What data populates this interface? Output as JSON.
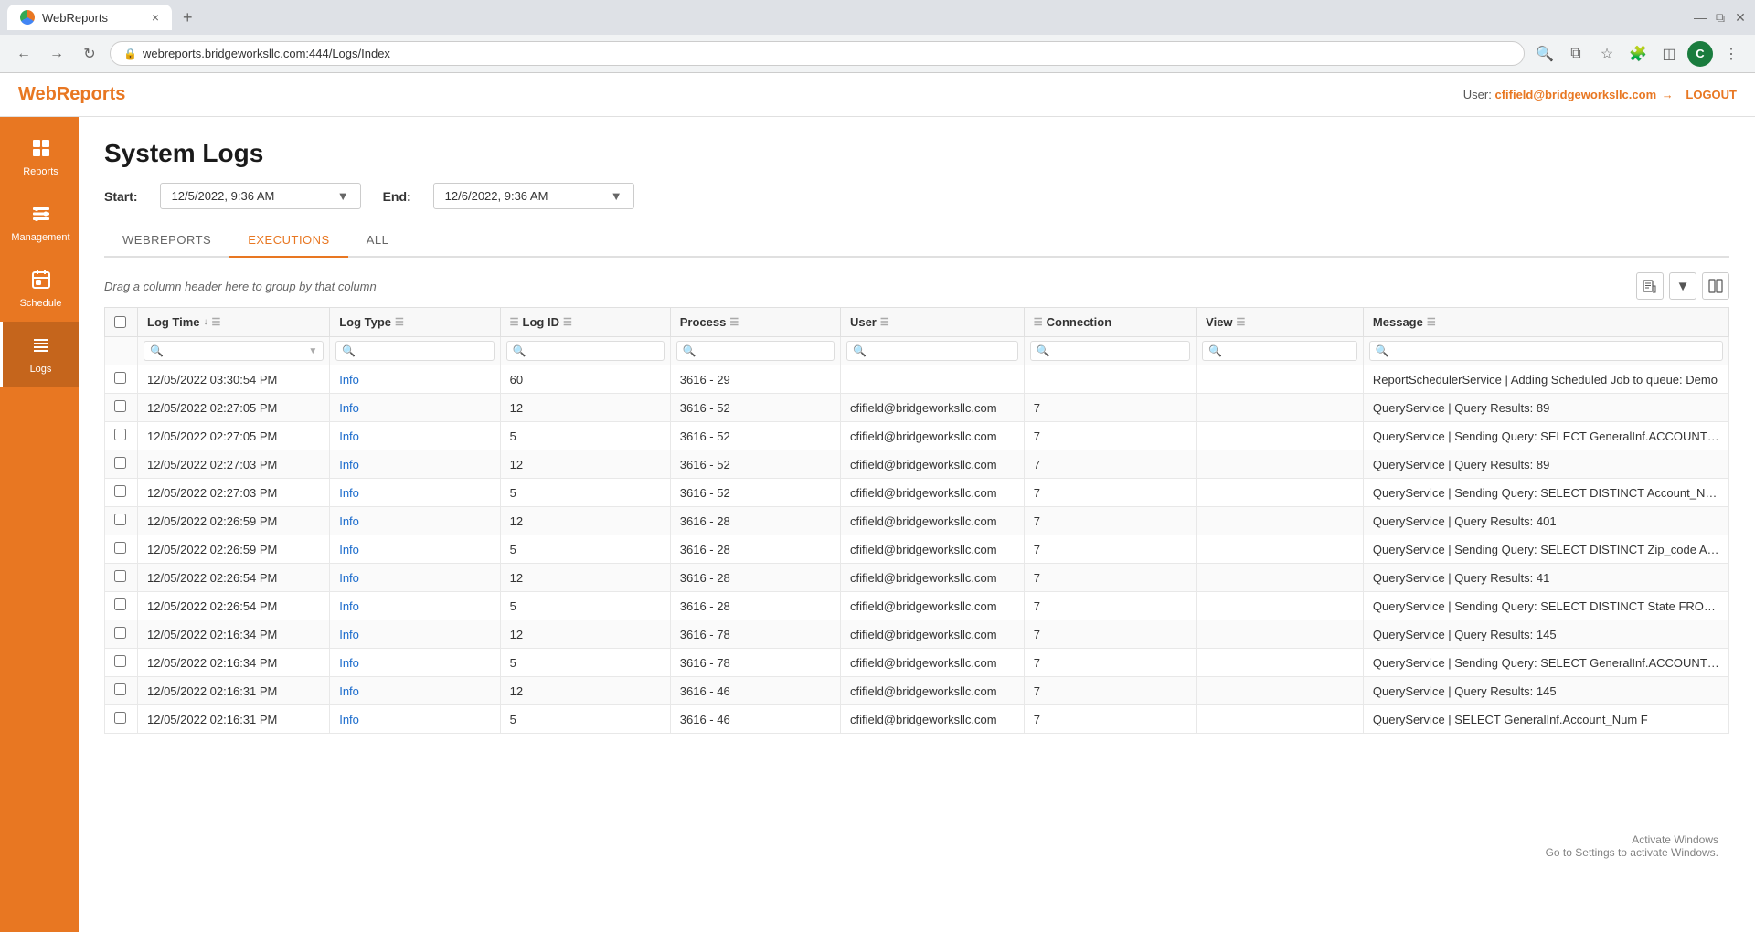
{
  "browser": {
    "tab_title": "WebReports",
    "tab_close": "×",
    "tab_new": "+",
    "url": "webreports.bridgeworksllc.com:444/Logs/Index",
    "win_minimize": "—",
    "win_restore": "❐",
    "win_close": "✕",
    "profile_initial": "C"
  },
  "app": {
    "brand": "WebReports",
    "user_label": "User:",
    "user_email": "cfifield@bridgeworksllc.com",
    "logout_label": "LOGOUT"
  },
  "sidebar": {
    "items": [
      {
        "id": "reports",
        "label": "Reports",
        "icon": "⊞"
      },
      {
        "id": "management",
        "label": "Management",
        "icon": "⊟"
      },
      {
        "id": "schedule",
        "label": "Schedule",
        "icon": "⊞"
      },
      {
        "id": "logs",
        "label": "Logs",
        "icon": "≡"
      }
    ]
  },
  "page": {
    "title": "System Logs",
    "start_label": "Start:",
    "end_label": "End:",
    "start_value": "12/5/2022, 9:36 AM",
    "end_value": "12/6/2022, 9:36 AM"
  },
  "tabs": [
    {
      "id": "webreports",
      "label": "WEBREPORTS"
    },
    {
      "id": "executions",
      "label": "EXECUTIONS"
    },
    {
      "id": "all",
      "label": "ALL"
    }
  ],
  "table": {
    "drag_hint": "Drag a column header here to group by that column",
    "columns": [
      {
        "id": "checkbox",
        "label": ""
      },
      {
        "id": "logtime",
        "label": "Log Time",
        "sort": true,
        "filter": true
      },
      {
        "id": "logtype",
        "label": "Log Type",
        "filter": true
      },
      {
        "id": "logid",
        "label": "Log ID",
        "filter": true
      },
      {
        "id": "process",
        "label": "Process",
        "filter": true
      },
      {
        "id": "user",
        "label": "User",
        "filter": true
      },
      {
        "id": "connection",
        "label": "Connection",
        "filter": true
      },
      {
        "id": "view",
        "label": "View",
        "filter": true
      },
      {
        "id": "message",
        "label": "Message",
        "filter": true
      }
    ],
    "rows": [
      {
        "logtime": "12/05/2022 03:30:54 PM",
        "logtype": "Info",
        "logid": "60",
        "process": "3616 - 29",
        "user": "",
        "connection": "",
        "view": "",
        "message": "ReportSchedulerService | Adding Scheduled Job to queue: Demo"
      },
      {
        "logtime": "12/05/2022 02:27:05 PM",
        "logtype": "Info",
        "logid": "12",
        "process": "3616 - 52",
        "user": "cfifield@bridgeworksllc.com",
        "connection": "7",
        "view": "",
        "message": "QueryService | Query Results: 89"
      },
      {
        "logtime": "12/05/2022 02:27:05 PM",
        "logtype": "Info",
        "logid": "5",
        "process": "3616 - 52",
        "user": "cfifield@bridgeworksllc.com",
        "connection": "7",
        "view": "",
        "message": "QueryService | Sending Query: SELECT GeneralInf.ACCOUNT_NUM"
      },
      {
        "logtime": "12/05/2022 02:27:03 PM",
        "logtype": "Info",
        "logid": "12",
        "process": "3616 - 52",
        "user": "cfifield@bridgeworksllc.com",
        "connection": "7",
        "view": "",
        "message": "QueryService | Query Results: 89"
      },
      {
        "logtime": "12/05/2022 02:27:03 PM",
        "logtype": "Info",
        "logid": "5",
        "process": "3616 - 52",
        "user": "cfifield@bridgeworksllc.com",
        "connection": "7",
        "view": "",
        "message": "QueryService | Sending Query: SELECT DISTINCT Account_Num F"
      },
      {
        "logtime": "12/05/2022 02:26:59 PM",
        "logtype": "Info",
        "logid": "12",
        "process": "3616 - 28",
        "user": "cfifield@bridgeworksllc.com",
        "connection": "7",
        "view": "",
        "message": "QueryService | Query Results: 401"
      },
      {
        "logtime": "12/05/2022 02:26:59 PM",
        "logtype": "Info",
        "logid": "5",
        "process": "3616 - 28",
        "user": "cfifield@bridgeworksllc.com",
        "connection": "7",
        "view": "",
        "message": "QueryService | Sending Query: SELECT DISTINCT Zip_code AS ZIF"
      },
      {
        "logtime": "12/05/2022 02:26:54 PM",
        "logtype": "Info",
        "logid": "12",
        "process": "3616 - 28",
        "user": "cfifield@bridgeworksllc.com",
        "connection": "7",
        "view": "",
        "message": "QueryService | Query Results: 41"
      },
      {
        "logtime": "12/05/2022 02:26:54 PM",
        "logtype": "Info",
        "logid": "5",
        "process": "3616 - 28",
        "user": "cfifield@bridgeworksllc.com",
        "connection": "7",
        "view": "",
        "message": "QueryService | Sending Query: SELECT DISTINCT State FROM SQL"
      },
      {
        "logtime": "12/05/2022 02:16:34 PM",
        "logtype": "Info",
        "logid": "12",
        "process": "3616 - 78",
        "user": "cfifield@bridgeworksllc.com",
        "connection": "7",
        "view": "",
        "message": "QueryService | Query Results: 145"
      },
      {
        "logtime": "12/05/2022 02:16:34 PM",
        "logtype": "Info",
        "logid": "5",
        "process": "3616 - 78",
        "user": "cfifield@bridgeworksllc.com",
        "connection": "7",
        "view": "",
        "message": "QueryService | Sending Query: SELECT GeneralInf.ACCOUNT_NUM"
      },
      {
        "logtime": "12/05/2022 02:16:31 PM",
        "logtype": "Info",
        "logid": "12",
        "process": "3616 - 46",
        "user": "cfifield@bridgeworksllc.com",
        "connection": "7",
        "view": "",
        "message": "QueryService | Query Results: 145"
      },
      {
        "logtime": "12/05/2022 02:16:31 PM",
        "logtype": "Info",
        "logid": "5",
        "process": "3616 - 46",
        "user": "cfifield@bridgeworksllc.com",
        "connection": "7",
        "view": "",
        "message": "QueryService | SELECT GeneralInf.Account_Num F"
      }
    ]
  },
  "watermark": {
    "line1": "Activate Windows",
    "line2": "Go to Settings to activate Windows."
  },
  "icons": {
    "search": "🔍",
    "back": "←",
    "forward": "→",
    "refresh": "↻",
    "lock": "🔒",
    "star": "☆",
    "extensions": "🧩",
    "sidebar_toggle": "⊡",
    "more": "⋮",
    "export": "📄",
    "column_chooser": "⊞",
    "dropdown_arrow": "▾",
    "sort_desc": "↓",
    "filter_icon": "≡"
  }
}
